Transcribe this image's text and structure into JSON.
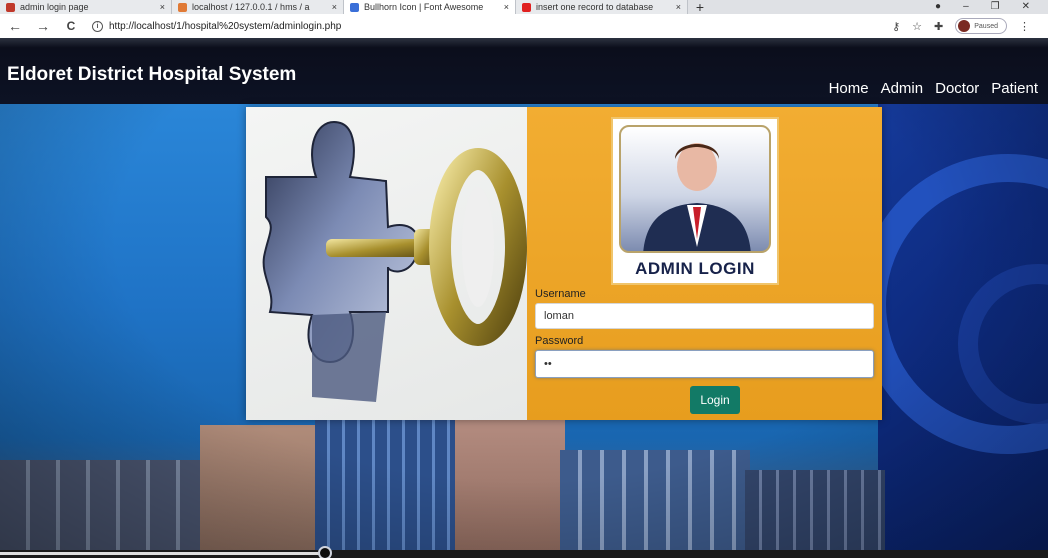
{
  "browser": {
    "tabs": [
      {
        "title": "admin login page",
        "active": false,
        "icon_color": "#c0392b"
      },
      {
        "title": "localhost / 127.0.0.1 / hms / a",
        "active": false,
        "icon_color": "#e07a36"
      },
      {
        "title": "Bullhorn Icon | Font Awesome",
        "active": true,
        "icon_color": "#3a6fd8"
      },
      {
        "title": "insert one record to database",
        "active": false,
        "icon_color": "#e02020"
      }
    ],
    "close_glyph": "×",
    "new_tab_glyph": "+",
    "window_controls": [
      "●",
      "–",
      "❐",
      "✕"
    ],
    "nav": {
      "back": "←",
      "forward": "→",
      "reload": "C"
    },
    "url": "http://localhost/1/hospital%20system/adminlogin.php",
    "toolbar_icons": [
      "key-icon",
      "star-icon",
      "puzzle-icon"
    ],
    "toolbar_glyphs": {
      "key": "⚷",
      "star": "☆",
      "puzzle": "✚",
      "menu": "⋮"
    },
    "profile_status": "Paused"
  },
  "site": {
    "brand": "Eldoret District Hospital System",
    "nav_links": [
      "Home",
      "Admin",
      "Doctor",
      "Patient"
    ]
  },
  "login": {
    "badge_text": "ADMIN LOGIN",
    "username_label": "Username",
    "username_value": "loman",
    "password_label": "Password",
    "password_value": "••",
    "login_button": "Login"
  },
  "video": {
    "progress_fraction": 0.31
  },
  "colors": {
    "navbar": "#0b0e1c",
    "panel_orange": "#f2ad32",
    "login_button": "#127a66",
    "hero_sky": "#2a86d8"
  }
}
